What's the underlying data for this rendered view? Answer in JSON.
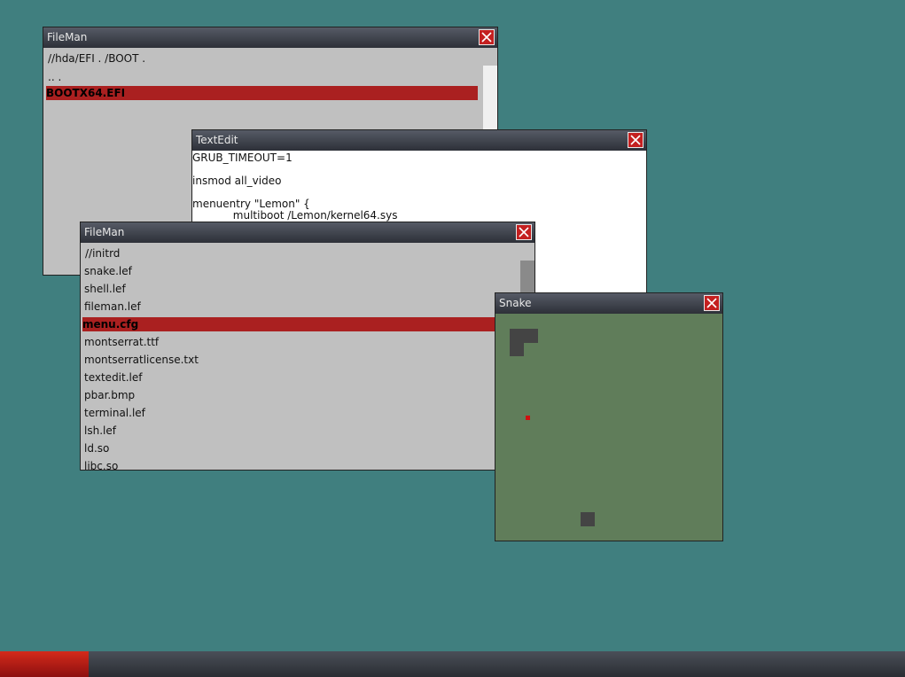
{
  "desktop": {
    "background": "#407f7f"
  },
  "fileman_boot": {
    "title": "FileMan",
    "path": "//hda/EFI   .   /BOOT   .",
    "items": [
      {
        "label": "..   .",
        "selected": false
      },
      {
        "label": "BOOTX64.EFI",
        "selected": true
      }
    ]
  },
  "textedit": {
    "title": "TextEdit",
    "lines": [
      "GRUB_TIMEOUT=1",
      "insmod all_video",
      "menuentry \"Lemon\" {",
      "            multiboot /Lemon/kernel64.sys"
    ]
  },
  "fileman_initrd": {
    "title": "FileMan",
    "path": "//initrd",
    "items": [
      {
        "label": "snake.lef",
        "selected": false
      },
      {
        "label": "shell.lef",
        "selected": false
      },
      {
        "label": "fileman.lef",
        "selected": false
      },
      {
        "label": "menu.cfg",
        "selected": true
      },
      {
        "label": "montserrat.ttf",
        "selected": false
      },
      {
        "label": "montserratlicense.txt",
        "selected": false
      },
      {
        "label": "textedit.lef",
        "selected": false
      },
      {
        "label": "pbar.bmp",
        "selected": false
      },
      {
        "label": "terminal.lef",
        "selected": false
      },
      {
        "label": "lsh.lef",
        "selected": false
      },
      {
        "label": "ld.so",
        "selected": false
      },
      {
        "label": "libc.so",
        "selected": false
      }
    ]
  },
  "snake": {
    "title": "Snake"
  },
  "colors": {
    "selection": "#aa2020",
    "close": "#c42020",
    "snake_field": "#607d5a",
    "snake_body": "#444444",
    "food": "#d01010"
  },
  "icons": {
    "close": "close-icon"
  }
}
